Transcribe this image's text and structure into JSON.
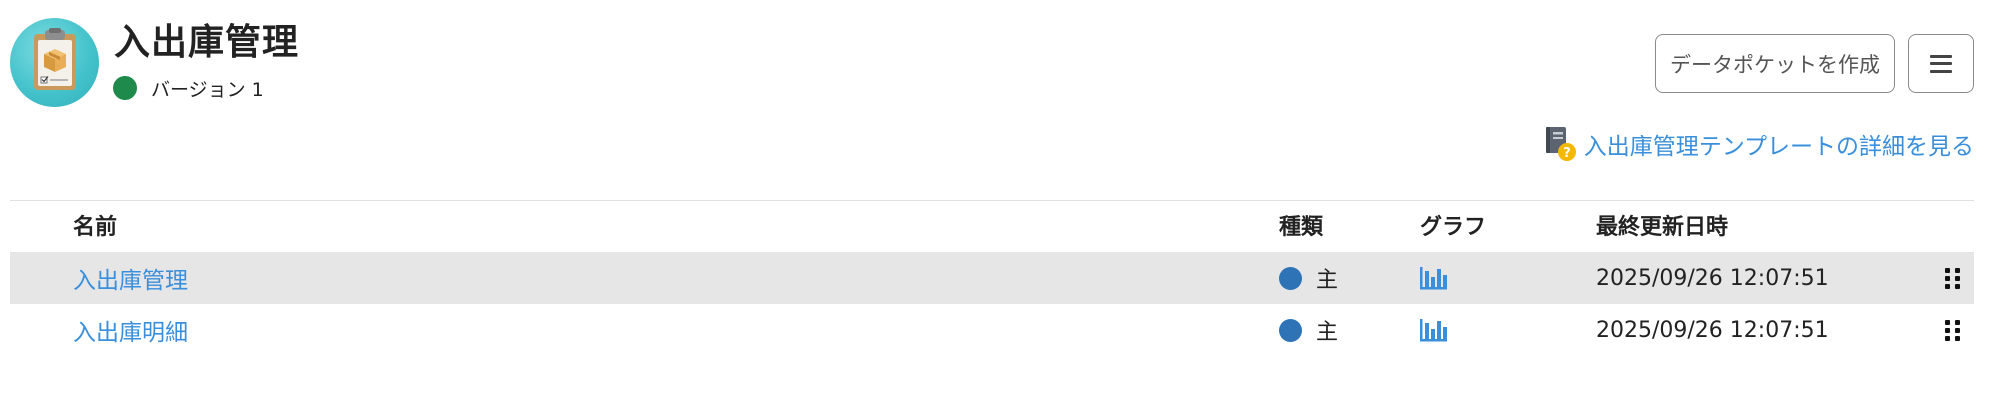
{
  "header": {
    "title": "入出庫管理",
    "app_icon": "clipboard-box-icon",
    "version_status_color": "#1e8a4c",
    "version_label": "バージョン 1"
  },
  "actions": {
    "create_datapocket_label": "データポケットを作成",
    "menu_icon": "hamburger-icon"
  },
  "template_link": {
    "icon": "document-help-icon",
    "label": "入出庫管理テンプレートの詳細を見る",
    "color": "#3a8fdc"
  },
  "table": {
    "columns": [
      "名前",
      "種類",
      "グラフ",
      "最終更新日時"
    ],
    "rows": [
      {
        "name": "入出庫管理",
        "type": "主",
        "type_color": "#2d73b6",
        "graph_icon": "bar-chart-icon",
        "updated": "2025/09/26 12:07:51",
        "highlighted": true
      },
      {
        "name": "入出庫明細",
        "type": "主",
        "type_color": "#2d73b6",
        "graph_icon": "bar-chart-icon",
        "updated": "2025/09/26 12:07:51",
        "highlighted": false
      }
    ]
  }
}
